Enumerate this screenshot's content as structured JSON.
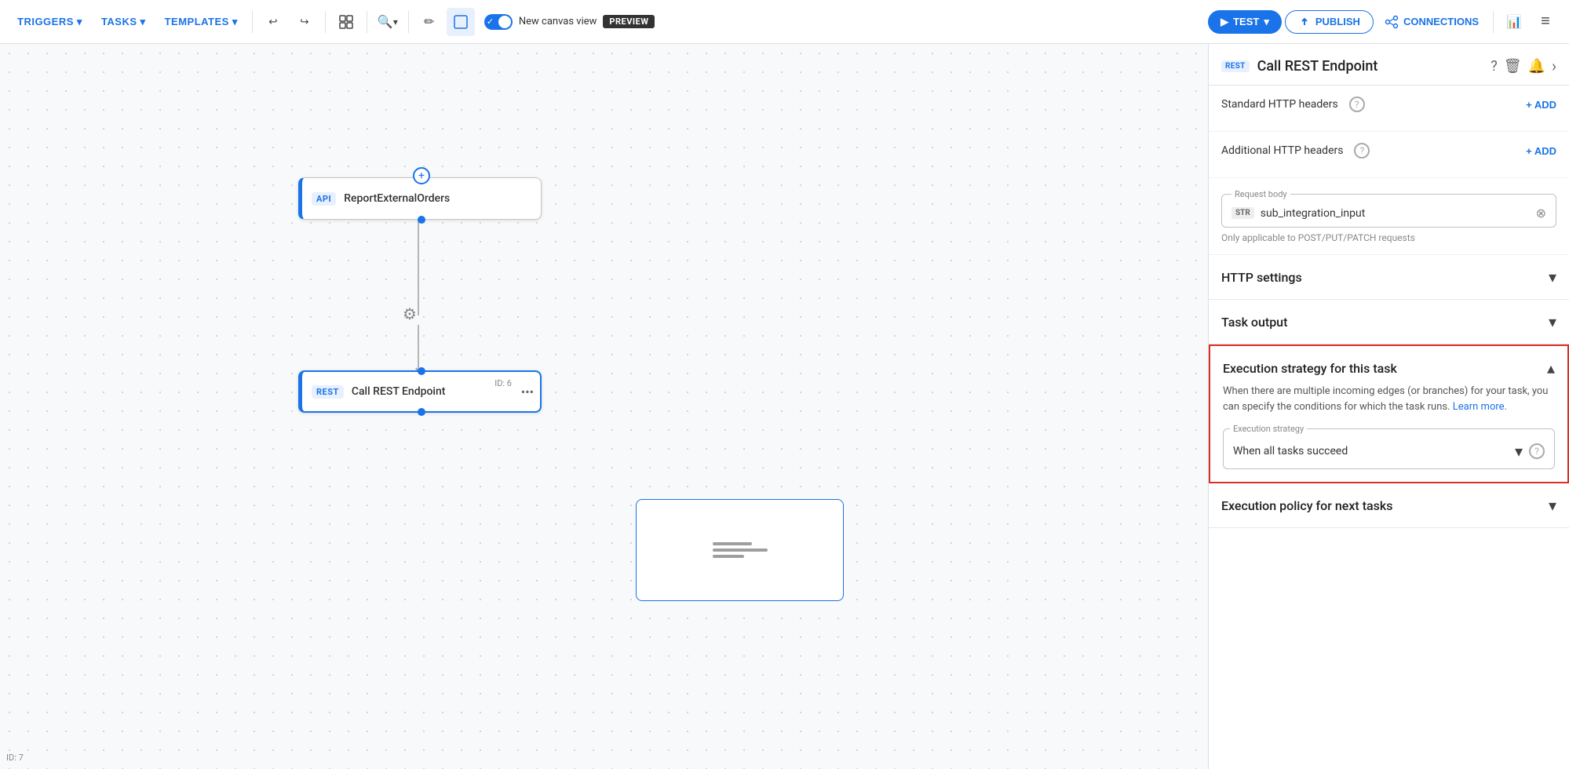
{
  "toolbar": {
    "triggers_label": "TRIGGERS",
    "tasks_label": "TASKS",
    "templates_label": "TEMPLATES",
    "canvas_view_label": "New canvas view",
    "preview_badge": "PREVIEW",
    "test_label": "TEST",
    "publish_label": "PUBLISH",
    "connections_label": "CONNECTIONS"
  },
  "canvas": {
    "node_api_badge": "API",
    "node_api_label": "ReportExternalOrders",
    "node_rest_badge": "REST",
    "node_rest_label": "Call REST Endpoint",
    "node_rest_id": "ID: 6",
    "canvas_id": "ID: 7"
  },
  "panel": {
    "rest_badge": "REST",
    "title": "Call REST Endpoint",
    "standard_http_headers_label": "Standard HTTP headers",
    "additional_http_headers_label": "Additional HTTP headers",
    "add_label": "+ ADD",
    "request_body_legend": "Request body",
    "str_badge": "STR",
    "request_body_value": "sub_integration_input",
    "request_body_helper": "Only applicable to POST/PUT/PATCH requests",
    "http_settings_label": "HTTP settings",
    "task_output_label": "Task output",
    "exec_strategy_this_title": "Execution strategy for this task",
    "exec_strategy_desc": "When there are multiple incoming edges (or branches) for your task, you can specify the conditions for which the task runs.",
    "learn_more_label": "Learn more.",
    "exec_strategy_legend": "Execution strategy",
    "exec_strategy_value": "When all tasks succeed",
    "exec_policy_next_title": "Execution policy for next tasks"
  },
  "icons": {
    "question": "?",
    "bell": "🔔",
    "chevron_right": "›",
    "chevron_down": "▾",
    "chevron_up": "▴",
    "gear": "⚙",
    "trash": "🗑",
    "undo": "↩",
    "redo": "↪",
    "zoom": "🔍",
    "pen": "✏",
    "layout": "⊞",
    "play": "▶",
    "chart": "📊",
    "menu": "≡",
    "connections": "🔗",
    "plus": "+",
    "close": "✕",
    "more": "•••"
  },
  "colors": {
    "blue": "#1a73e8",
    "red_border": "#d93025",
    "text_dark": "#202124",
    "text_mid": "#555",
    "text_light": "#888"
  }
}
